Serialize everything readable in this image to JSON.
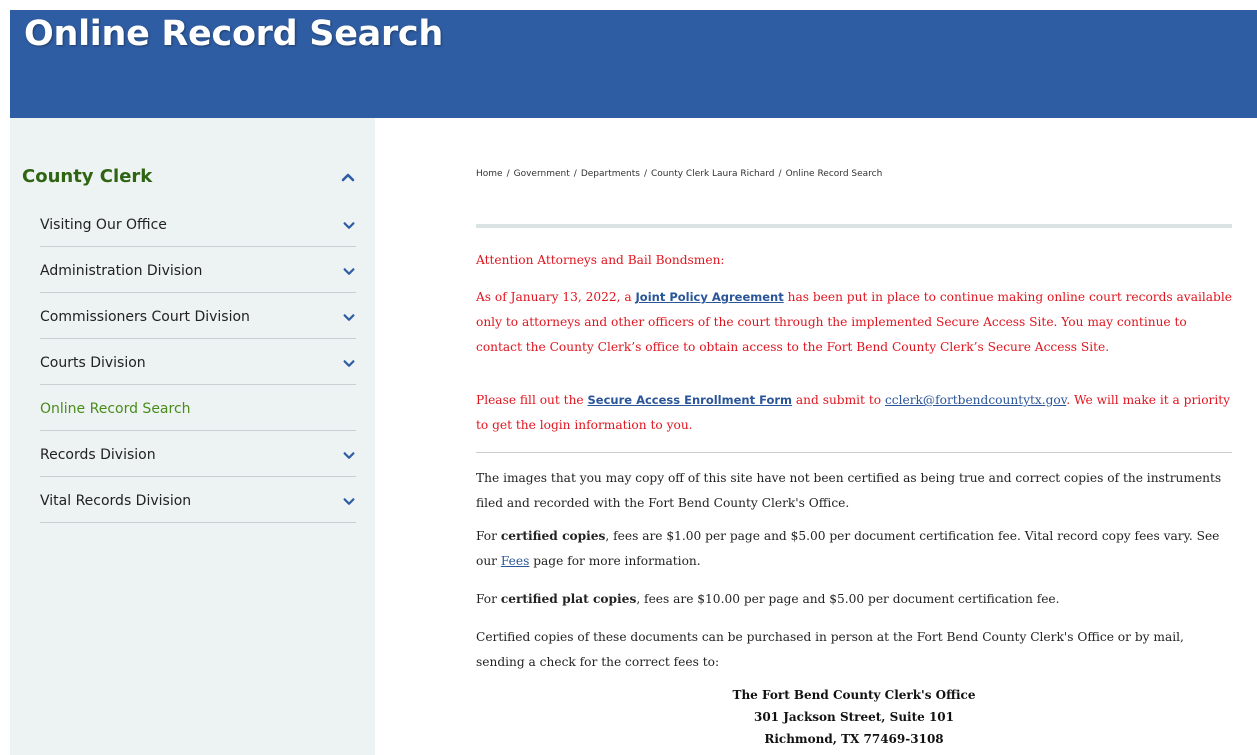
{
  "header": {
    "title": "Online Record Search",
    "background": "#2f5da3"
  },
  "sidebar": {
    "heading": "County Clerk",
    "heading_color": "#2e6412",
    "items": [
      {
        "label": "Visiting Our Office",
        "expandable": true
      },
      {
        "label": "Administration Division",
        "expandable": true
      },
      {
        "label": "Commissioners Court Division",
        "expandable": true
      },
      {
        "label": "Courts Division",
        "expandable": true
      },
      {
        "label": "Online Record Search",
        "expandable": false,
        "active": true
      },
      {
        "label": "Records Division",
        "expandable": true
      },
      {
        "label": "Vital Records Division",
        "expandable": true
      }
    ]
  },
  "breadcrumb": {
    "separator": "/",
    "items": [
      "Home",
      "Government",
      "Departments",
      "County Clerk Laura Richard",
      "Online Record Search"
    ]
  },
  "notice": {
    "heading": "Attention Attorneys and Bail Bondsmen:",
    "p1_before": "As of January 13, 2022, a ",
    "p1_link": "Joint Policy Agreement",
    "p1_after": " has been put in place to continue making online court records available only to attorneys and other officers of the court through the implemented Secure Access Site. You may continue to contact the County Clerk’s office to obtain access to the Fort Bend County Clerk’s Secure Access Site.",
    "p2_before": "Please fill out the ",
    "p2_link": "Secure Access Enrollment Form",
    "p2_mid": " and submit to ",
    "p2_email": "cclerk@fortbendcountytx.gov",
    "p2_after": ".  We will make it a priority to get the login information to you.",
    "color": "#e0141e"
  },
  "body": {
    "p3": "The images that you may copy off of this site have not been certified as being true and correct copies of the instruments filed and recorded with the Fort Bend County Clerk's Office.",
    "p4_before": "For ",
    "p4_bold": "certified copies",
    "p4_after": ", fees are $1.00 per page and $5.00 per document certification fee. Vital record copy fees vary. See our ",
    "p4_link": "Fees",
    "p4_end": " page for more information.",
    "p5_before": "For ",
    "p5_bold": "certified plat copies",
    "p5_after": ", fees are $10.00 per page and $5.00 per document certification fee.",
    "p6": "Certified copies of these documents can be purchased in person at the Fort Bend County Clerk's Office or by mail, sending a check for the correct fees to:"
  },
  "address": {
    "line1": "The Fort Bend County Clerk's Office",
    "line2": "301 Jackson Street, Suite 101",
    "line3": "Richmond, TX 77469-3108"
  },
  "icons": {
    "collapse": "chevron-up-icon",
    "expand": "chevron-down-icon",
    "chevron_color": "#2f5da3"
  }
}
